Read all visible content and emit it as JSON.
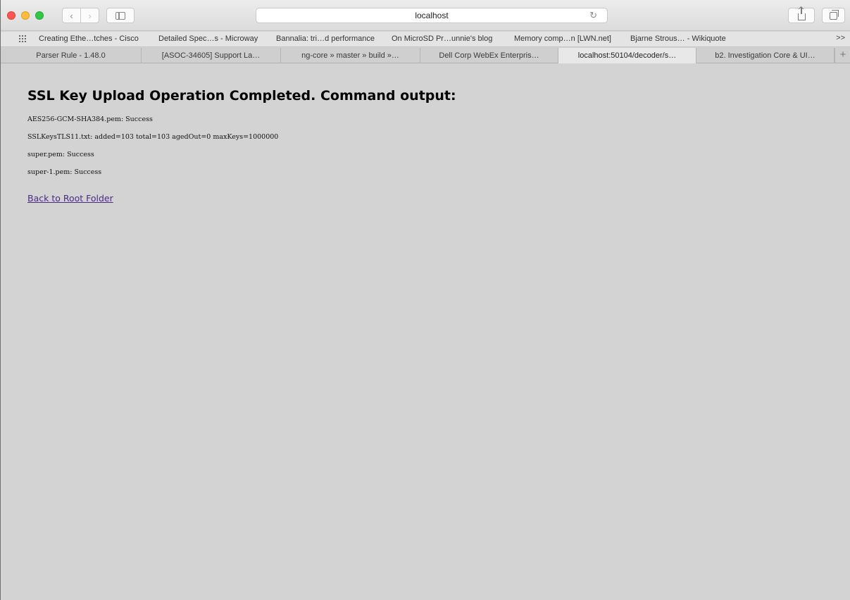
{
  "browser": {
    "url_text": "localhost",
    "bookmarks": [
      "Creating Ethe…tches - Cisco",
      "Detailed Spec…s - Microway",
      "Bannalia: tri…d performance",
      "On MicroSD Pr…unnie's blog",
      "Memory comp…n [LWN.net]",
      "Bjarne Strous… - Wikiquote"
    ],
    "bookmarks_more": ">>",
    "tabs": [
      "Parser Rule - 1.48.0",
      "[ASOC-34605] Support La…",
      "ng-core » master » build »…",
      "Dell Corp WebEx Enterpris…",
      "localhost:50104/decoder/s…",
      "b2. Investigation Core & UI…"
    ],
    "active_tab_index": 4,
    "new_tab_label": "+"
  },
  "page": {
    "heading": "SSL Key Upload Operation Completed. Command output:",
    "output_lines": [
      "AES256-GCM-SHA384.pem: Success",
      "SSLKeysTLS11.txt: added=103 total=103 agedOut=0 maxKeys=1000000",
      "super.pem: Success",
      "super-1.pem: Success"
    ],
    "back_link": "Back to Root Folder"
  },
  "colors": {
    "page_background": "#d3d3d3",
    "link": "#4b2a85"
  }
}
